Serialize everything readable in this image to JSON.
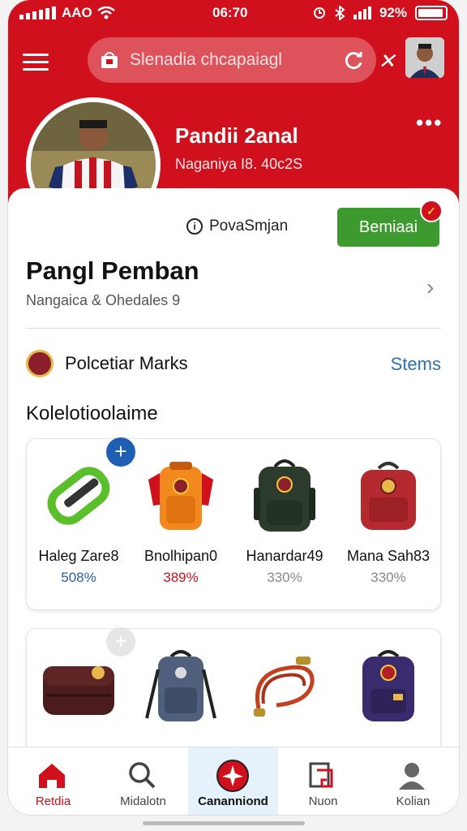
{
  "status_bar": {
    "carrier": "AAO",
    "time": "06:70",
    "battery": "92%"
  },
  "search": {
    "placeholder": "Slenadia chcapaiagl"
  },
  "profile": {
    "name": "Pandii 2anal",
    "subtitle": "Naganiya I8. 40c2S",
    "handle": "PovaSmjan",
    "action_label": "Bemiaai"
  },
  "section": {
    "title": "Pangl Pemban",
    "subtitle": "Nangaica & Ohedales 9"
  },
  "marks": {
    "label": "Polcetiar Marks",
    "link": "Stems"
  },
  "collection": {
    "title": "Kolelotioolaime",
    "row1": [
      {
        "name": "Haleg Zare8",
        "pct": "508%",
        "pct_color": "#2b5fa8",
        "icon": "green-carabiner-icon"
      },
      {
        "name": "Bnolhipan0",
        "pct": "389%",
        "pct_color": "#d0101c",
        "icon": "orange-backpack-icon"
      },
      {
        "name": "Hanardar49",
        "pct": "330%",
        "pct_color": "#888888",
        "icon": "dark-green-backpack-icon"
      },
      {
        "name": "Mana Sah83",
        "pct": "330%",
        "pct_color": "#888888",
        "icon": "red-backpack-icon"
      }
    ],
    "row2": [
      {
        "icon": "maroon-case-icon"
      },
      {
        "icon": "blue-backpack-icon"
      },
      {
        "icon": "rope-icon"
      },
      {
        "icon": "purple-backpack-icon"
      }
    ]
  },
  "nav": [
    {
      "label": "Retdia",
      "icon": "home-icon"
    },
    {
      "label": "Midalotn",
      "icon": "search-icon"
    },
    {
      "label": "Cananniond",
      "icon": "plane-icon"
    },
    {
      "label": "Nuon",
      "icon": "grid-logo-icon"
    },
    {
      "label": "Kolian",
      "icon": "profile-icon"
    }
  ]
}
